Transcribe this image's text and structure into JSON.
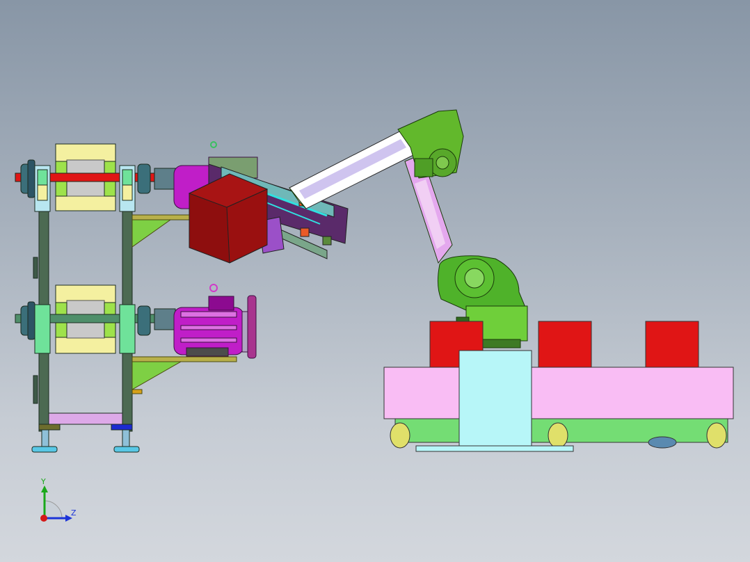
{
  "viewport": {
    "name": "cad-model-viewport",
    "background_top": "#8896a6",
    "background_bottom": "#d3d7dd"
  },
  "axes": {
    "y_label": "Y",
    "z_label": "Z",
    "y_color": "#1aa81a",
    "z_color": "#1c34d8",
    "x_color": "#d41818"
  },
  "colors": {
    "frame": "#4c6a52",
    "yellow_plate": "#f4f0a0",
    "shaft_red": "#e01515",
    "shaft_green": "#4f8f6a",
    "motor": "#c01ec8",
    "box": "#a01010",
    "robot_green": "#4fb22a",
    "robot_arm": "#e4a8ee",
    "platform_pink": "#f9bdf4",
    "platform_green": "#74dd74",
    "pedestal": "#b7f6f8",
    "red_block": "#e01515"
  }
}
